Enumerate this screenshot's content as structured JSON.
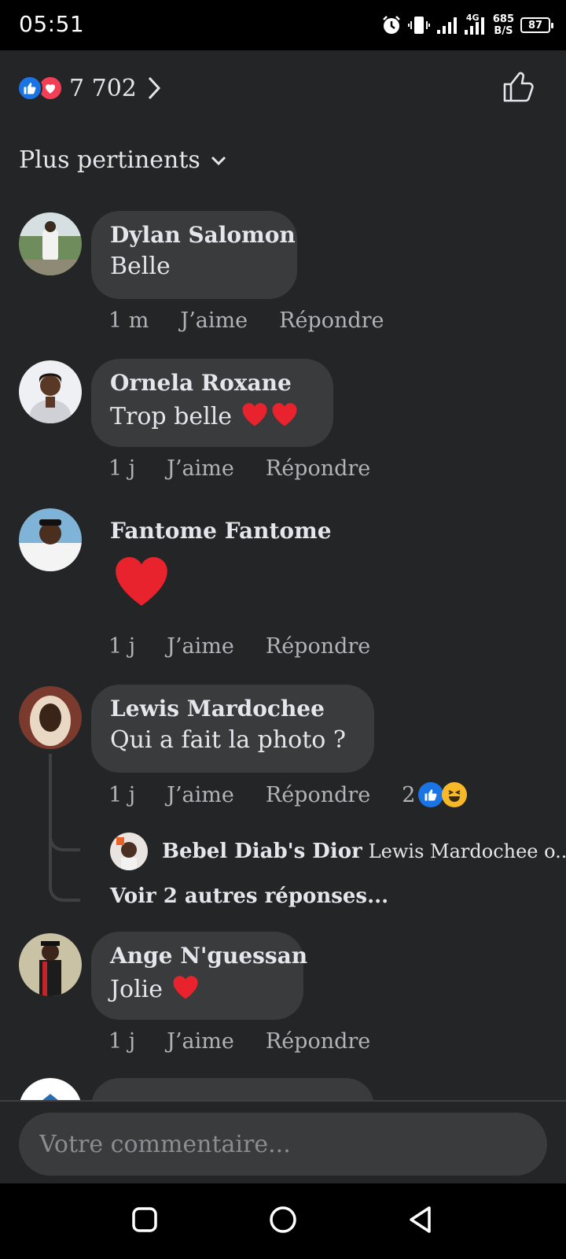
{
  "status_bar": {
    "time": "05:51",
    "network": "4G",
    "speed_value": "685",
    "speed_unit": "B/S",
    "battery": "87",
    "icons": [
      "alarm-icon",
      "vibrate-icon",
      "signal-icon",
      "signal-4g-icon"
    ]
  },
  "reactions": {
    "count": "7 702",
    "icons": [
      "like-reaction-icon",
      "love-reaction-icon"
    ]
  },
  "sort": {
    "label": "Plus pertinents"
  },
  "comments": [
    {
      "author": "Dylan Salomon",
      "text": "Belle",
      "time": "1 m",
      "like": "J’aime",
      "reply": "Répondre"
    },
    {
      "author": "Ornela Roxane",
      "text": "Trop belle",
      "emoji": "❤️❤️",
      "time": "1 j",
      "like": "J’aime",
      "reply": "Répondre"
    },
    {
      "author": "Fantome Fantome",
      "emoji": "❤️",
      "time": "1 j",
      "like": "J’aime",
      "reply": "Répondre"
    },
    {
      "author": "Lewis Mardochee",
      "text": "Qui a fait la photo ?",
      "time": "1 j",
      "like": "J’aime",
      "reply": "Répondre",
      "reaction_count": "2"
    },
    {
      "author": "Ange N'guessan",
      "text": "Jolie",
      "emoji": "❤️",
      "time": "1 j",
      "like": "J’aime",
      "reply": "Répondre"
    }
  ],
  "reply_preview": {
    "author": "Bebel Diab's Dior",
    "text": "Lewis Mardochee o...",
    "more": "Voir 2 autres réponses..."
  },
  "input": {
    "placeholder": "Votre commentaire..."
  },
  "colors": {
    "like_blue": "#1b74e4",
    "love_red": "#f33e58",
    "bubble": "#3a3b3c",
    "background": "#242526"
  }
}
